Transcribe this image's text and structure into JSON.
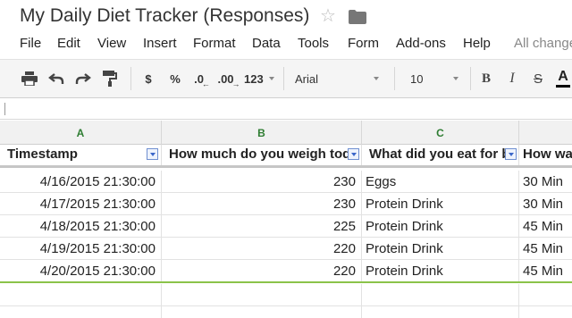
{
  "title": {
    "doc_title": "My Daily Diet Tracker (Responses)",
    "star": "☆"
  },
  "menu": {
    "items": [
      "File",
      "Edit",
      "View",
      "Insert",
      "Format",
      "Data",
      "Tools",
      "Form",
      "Add-ons",
      "Help"
    ],
    "status": "All changes"
  },
  "toolbar": {
    "currency": "$",
    "percent": "%",
    "decrease_decimal": ".0",
    "increase_decimal": ".00",
    "more_formats": "123",
    "font": "Arial",
    "font_size": "10",
    "bold": "B",
    "italic": "I",
    "strike": "S",
    "text_color": "A"
  },
  "sheet": {
    "columns": [
      "A",
      "B",
      "C"
    ],
    "headers": [
      "Timestamp",
      "How much do you weigh tod",
      "What did you eat for b",
      "How wa"
    ],
    "rows": [
      [
        "4/16/2015 21:30:00",
        "230",
        "Eggs",
        "30 Min"
      ],
      [
        "4/17/2015 21:30:00",
        "230",
        "Protein Drink",
        "30 Min"
      ],
      [
        "4/18/2015 21:30:00",
        "225",
        "Protein Drink",
        "45 Min"
      ],
      [
        "4/19/2015 21:30:00",
        "220",
        "Protein Drink",
        "45 Min"
      ],
      [
        "4/20/2015 21:30:00",
        "220",
        "Protein Drink",
        "45 Min"
      ]
    ]
  }
}
